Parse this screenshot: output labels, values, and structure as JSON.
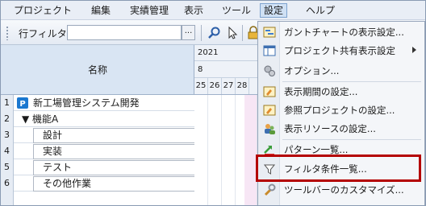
{
  "menubar": {
    "items": [
      "プロジェクト",
      "編集",
      "実績管理",
      "表示",
      "ツール",
      "設定",
      "ヘルプ"
    ],
    "active_index": 5
  },
  "toolbar": {
    "row_filter_label": "行フィルタ",
    "row_filter_value": "",
    "browse_label": "..."
  },
  "grid": {
    "name_header": "名称",
    "rows": [
      {
        "num": "1",
        "name": "新工場管理システム開発",
        "level": 0,
        "type": "project"
      },
      {
        "num": "2",
        "name": "▼ 機能A",
        "level": 1,
        "type": "group"
      },
      {
        "num": "3",
        "name": "設計",
        "level": 2,
        "type": "task"
      },
      {
        "num": "4",
        "name": "実装",
        "level": 2,
        "type": "task"
      },
      {
        "num": "5",
        "name": "テスト",
        "level": 2,
        "type": "task"
      },
      {
        "num": "6",
        "name": "その他作業",
        "level": 2,
        "type": "task"
      }
    ]
  },
  "gantt": {
    "year": "2021",
    "month": "8",
    "days": [
      "25",
      "26",
      "27",
      "28"
    ]
  },
  "settings_menu": {
    "items": [
      {
        "label": "ガントチャートの表示設定...",
        "icon": "gantt-settings-icon"
      },
      {
        "label": "プロジェクト共有表示設定",
        "icon": "shared-view-icon",
        "submenu": true
      },
      {
        "label": "オプション...",
        "icon": "options-gear-icon"
      },
      {
        "label": "表示期間の設定...",
        "icon": "period-settings-icon"
      },
      {
        "label": "参照プロジェクトの設定...",
        "icon": "reference-project-icon"
      },
      {
        "label": "表示リソースの設定...",
        "icon": "resource-settings-icon"
      },
      {
        "label": "パターン一覧...",
        "icon": "pattern-list-icon"
      },
      {
        "label": "フィルタ条件一覧...",
        "icon": "filter-icon",
        "highlighted": true
      },
      {
        "label": "ツールバーのカスタマイズ...",
        "icon": "wrench-icon"
      }
    ]
  },
  "colors": {
    "highlight_border": "#b40000",
    "weekend_fill": "#f7e6f5",
    "project_badge": "#1b78d0"
  }
}
